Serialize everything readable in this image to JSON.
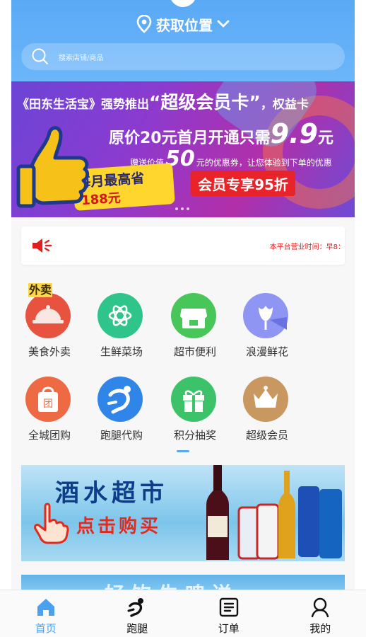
{
  "header": {
    "location_label": "获取位置",
    "search_placeholder": "搜索店铺/商品"
  },
  "banner": {
    "line1_prefix": "《田东生活宝》强势推出",
    "line1_highlight": "“超级会员卡”",
    "line1_suffix": "，权益卡",
    "line2_text": "原价20元首月开通只需",
    "line2_price": "9.9",
    "line2_unit": "元",
    "line3_prefix": "赠送价值",
    "line3_amount": "50",
    "line3_suffix": "元的优惠券，让您体验到下单的优惠",
    "save_line1": "每月最高省",
    "save_line2": "188元",
    "vip_button": "会员专享95折"
  },
  "notice": {
    "text": "本平台营业时间：早8："
  },
  "categories": [
    {
      "label": "美食外卖",
      "icon": "cloche-icon",
      "badge": "外卖"
    },
    {
      "label": "生鲜菜场",
      "icon": "produce-icon"
    },
    {
      "label": "超市便利",
      "icon": "store-icon"
    },
    {
      "label": "浪漫鲜花",
      "icon": "flower-icon"
    },
    {
      "label": "全城团购",
      "icon": "group-buy-bag-icon",
      "badge": "团"
    },
    {
      "label": "跑腿代购",
      "icon": "runner-icon"
    },
    {
      "label": "积分抽奖",
      "icon": "gift-icon"
    },
    {
      "label": "超级会员",
      "icon": "crown-icon"
    }
  ],
  "promo": {
    "title": "酒水超市",
    "cta": "点击购买",
    "next_title": "好饮生啤送"
  },
  "tabbar": [
    {
      "label": "首页",
      "icon": "home-icon",
      "active": true
    },
    {
      "label": "跑腿",
      "icon": "runner-tab-icon",
      "active": false
    },
    {
      "label": "订单",
      "icon": "order-icon",
      "active": false
    },
    {
      "label": "我的",
      "icon": "profile-icon",
      "active": false
    }
  ],
  "colors": {
    "header_blue": "#5aa9f6",
    "active_tab": "#4aa1f0",
    "notice_red": "#e11d1d"
  }
}
